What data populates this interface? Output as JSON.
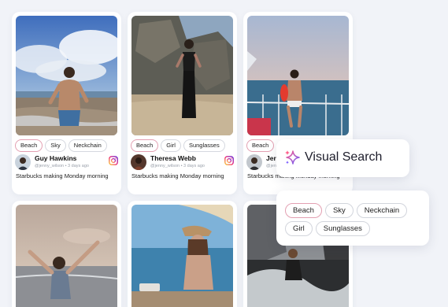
{
  "cards": [
    {
      "tags": [
        {
          "label": "Beach",
          "active": true
        },
        {
          "label": "Sky"
        },
        {
          "label": "Neckchain"
        }
      ],
      "author": {
        "name": "Guy Hawkins",
        "meta": "@jenny_wilson • 3 days ago"
      },
      "caption": "Starbucks making Monday morning",
      "icon": "instagram-icon"
    },
    {
      "tags": [
        {
          "label": "Beach",
          "active": true
        },
        {
          "label": "Girl"
        },
        {
          "label": "Sunglasses"
        }
      ],
      "author": {
        "name": "Theresa Webb",
        "meta": "@jenny_wilson • 3 days ago"
      },
      "caption": "Starbucks making Monday morning",
      "icon": "instagram-icon"
    },
    {
      "tags": [
        {
          "label": "Beach",
          "active": true
        }
      ],
      "author": {
        "name": "Jer",
        "meta": "@jenny_w"
      },
      "caption": "Starbucks making Monday morning"
    }
  ],
  "visual_search": {
    "label": "Visual Search",
    "icon": "sparkle-icon"
  },
  "tag_panel": {
    "row1": [
      {
        "label": "Beach",
        "active": true
      },
      {
        "label": "Sky"
      },
      {
        "label": "Neckchain"
      }
    ],
    "row2": [
      {
        "label": "Girl"
      },
      {
        "label": "Sunglasses"
      }
    ]
  },
  "colors": {
    "background": "#f1f3f8",
    "active_tag_border": "#e3a0b2",
    "instagram_gradient": [
      "#f9ce34",
      "#ee2a7b",
      "#6228d7"
    ]
  }
}
